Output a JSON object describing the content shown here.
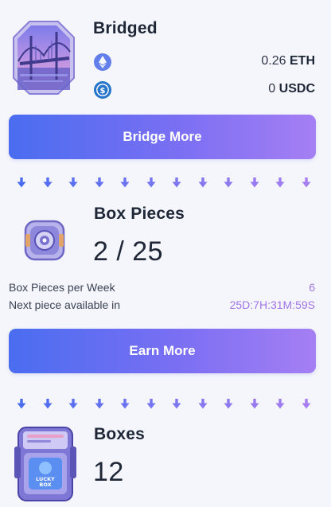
{
  "bridged": {
    "title": "Bridged",
    "eth": {
      "amount": "0.26",
      "unit": "ETH",
      "icon": "ethereum-icon"
    },
    "usdc": {
      "amount": "0",
      "unit": "USDC",
      "icon": "usdc-icon"
    },
    "button_label": "Bridge More"
  },
  "box_pieces": {
    "title": "Box Pieces",
    "count": "2 / 25",
    "per_week_label": "Box Pieces per Week",
    "per_week_value": "6",
    "next_label": "Next piece available in",
    "next_value": "25D:7H:31M:59S",
    "button_label": "Earn More"
  },
  "boxes": {
    "title": "Boxes",
    "count": "12",
    "box_text": "LUCKY BOX"
  },
  "colors": {
    "accent_start": "#4a6df0",
    "accent_end": "#a57ff3",
    "value_purple": "#a175e4"
  }
}
